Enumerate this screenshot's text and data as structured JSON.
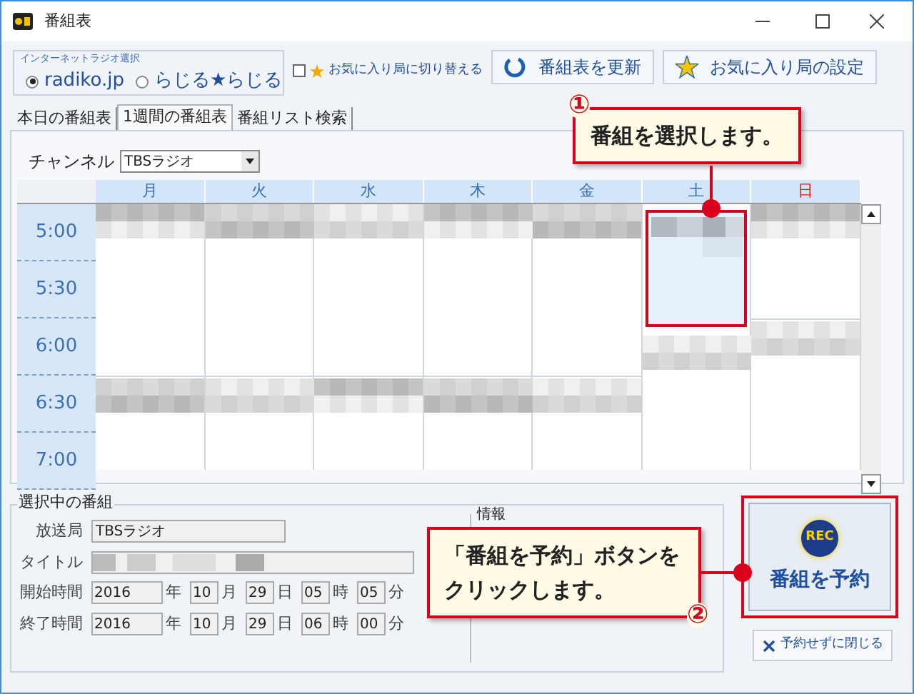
{
  "window": {
    "title": "番組表"
  },
  "radio_group": {
    "label": "インターネットラジオ選択",
    "options": [
      {
        "label": "radiko.jp",
        "selected": true
      },
      {
        "label": "らじる★らじる",
        "selected": false
      }
    ]
  },
  "favorite_toggle": {
    "label": "お気に入り局に切り替える",
    "checked": false
  },
  "toolbar_buttons": [
    {
      "kind": "refresh",
      "label": "番組表を更新"
    },
    {
      "kind": "star",
      "label": "お気に入り局の設定"
    }
  ],
  "tabs": [
    {
      "label": "本日の番組表",
      "selected": false
    },
    {
      "label": "1週間の番組表",
      "selected": true
    },
    {
      "label": "番組リスト検索",
      "selected": false
    }
  ],
  "channel": {
    "label": "チャンネル",
    "value": "TBSラジオ"
  },
  "schedule": {
    "days": [
      {
        "label": "月",
        "color": "#3a6fb5",
        "selected": false
      },
      {
        "label": "火",
        "color": "#3a6fb5",
        "selected": false
      },
      {
        "label": "水",
        "color": "#3a6fb5",
        "selected": false
      },
      {
        "label": "木",
        "color": "#3a6fb5",
        "selected": false
      },
      {
        "label": "金",
        "color": "#3a6fb5",
        "selected": false
      },
      {
        "label": "土",
        "color": "#3a6fb5",
        "selected": true
      },
      {
        "label": "日",
        "color": "#e02020",
        "selected": false
      }
    ],
    "times": [
      "5:00",
      "5:30",
      "6:00",
      "6:30",
      "7:00"
    ]
  },
  "selected_program": {
    "title": "選択中の番組",
    "station": {
      "label": "放送局",
      "value": "TBSラジオ"
    },
    "program_title": {
      "label": "タイトル"
    },
    "times": [
      {
        "label": "開始時間",
        "parts": [
          {
            "value": "2016",
            "unit": "年"
          },
          {
            "value": "10",
            "unit": "月"
          },
          {
            "value": "29",
            "unit": "日"
          },
          {
            "value": "05",
            "unit": "時"
          },
          {
            "value": "05",
            "unit": "分"
          }
        ]
      },
      {
        "label": "終了時間",
        "parts": [
          {
            "value": "2016",
            "unit": "年"
          },
          {
            "value": "10",
            "unit": "月"
          },
          {
            "value": "29",
            "unit": "日"
          },
          {
            "value": "06",
            "unit": "時"
          },
          {
            "value": "00",
            "unit": "分"
          }
        ]
      }
    ]
  },
  "info": {
    "label": "情報"
  },
  "reserve_button": {
    "badge": "REC",
    "label": "番組を予約"
  },
  "close_button": {
    "label": "予約せずに閉じる"
  },
  "callouts": [
    {
      "number": "①",
      "lines": [
        "番組を選択します。"
      ]
    },
    {
      "number": "②",
      "lines": [
        "「番組を予約」ボタンを",
        "クリックします。"
      ]
    }
  ]
}
